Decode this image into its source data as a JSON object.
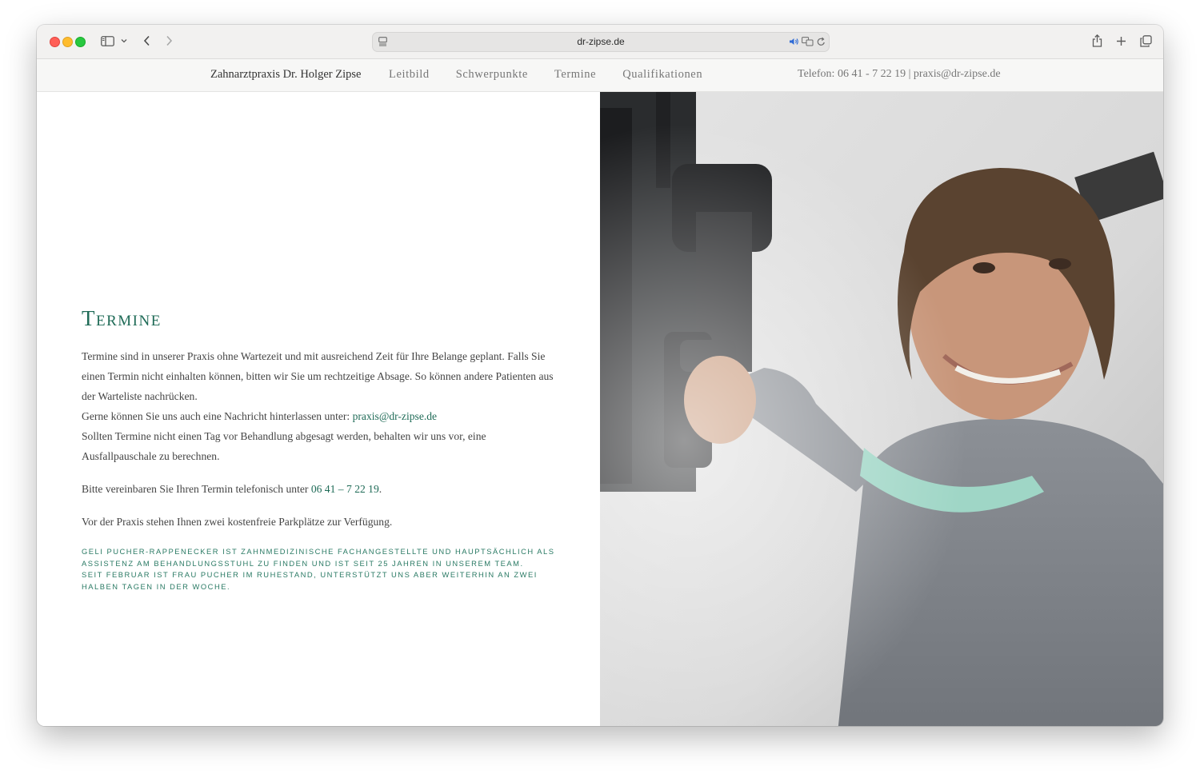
{
  "browser": {
    "url": "dr-zipse.de",
    "icons": [
      "sidebar-icon",
      "chevron-down-icon",
      "back-icon",
      "forward-icon",
      "page-icon",
      "audio-icon",
      "translate-icon",
      "reload-icon",
      "share-icon",
      "plus-icon",
      "tabs-icon"
    ]
  },
  "nav": {
    "brand": "Zahnarztpraxis Dr. Holger Zipse",
    "links": [
      "Leitbild",
      "Schwerpunkte",
      "Termine",
      "Qualifikationen"
    ],
    "contact": "Telefon: 06 41 - 7 22 19 | praxis@dr-zipse.de"
  },
  "content": {
    "title": "Termine",
    "p1_a": "Termine sind in unserer Praxis ohne Wartezeit und mit ausreichend Zeit für Ihre Belange geplant. Falls Sie einen Termin nicht einhalten können, bitten wir Sie um rechtzeitige Absage. So können andere Patienten aus der Warteliste nachrücken.",
    "p1_b": "Gerne können Sie uns auch eine Nachricht hinterlassen unter: ",
    "email": "praxis@dr-zipse.de",
    "p1_c": "Sollten Termine nicht einen Tag vor Behandlung abgesagt werden, behalten wir uns vor, eine Ausfallpauschale zu berechnen.",
    "p2_a": "Bitte vereinbaren Sie Ihren Termin telefonisch unter ",
    "phone": "06 41 – 7 22 19",
    "p2_b": ".",
    "p3": "Vor der Praxis stehen Ihnen zwei kostenfreie Parkplätze zur Verfügung.",
    "caption_1": "Geli Pucher-Rappenecker ist zahnmedizinische Fachangestellte und hauptsächlich als Assistenz am Behandlungsstuhl zu finden und ist seit 25 Jahren in unserem Team.",
    "caption_2": "Seit Februar ist Frau Pucher im Ruhestand, unterstützt uns aber weiterhin an zwei halben Tagen in der Woche."
  },
  "colors": {
    "accent": "#1f6b57"
  }
}
